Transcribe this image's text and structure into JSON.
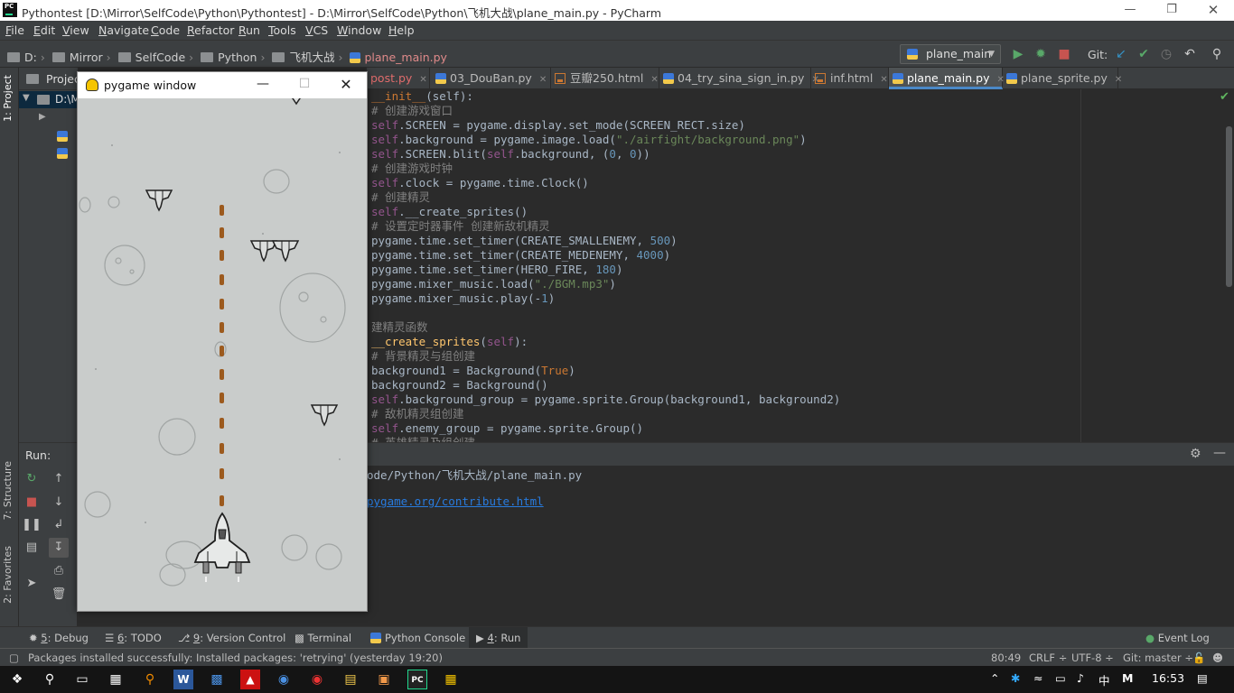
{
  "window_title": "Pythontest [D:\\Mirror\\SelfCode\\Python\\Pythontest] - D:\\Mirror\\SelfCode\\Python\\飞机大战\\plane_main.py - PyCharm",
  "menu": [
    {
      "label": "File",
      "u": "F",
      "rest": "ile"
    },
    {
      "label": "Edit",
      "u": "E",
      "rest": "dit"
    },
    {
      "label": "View",
      "u": "V",
      "rest": "iew"
    },
    {
      "label": "Navigate",
      "u": "N",
      "rest": "avigate"
    },
    {
      "label": "Code",
      "u": "C",
      "rest": "ode"
    },
    {
      "label": "Refactor",
      "u": "R",
      "rest": "efactor"
    },
    {
      "label": "Run",
      "u": "R",
      "rest": "un"
    },
    {
      "label": "Tools",
      "u": "T",
      "rest": "ools"
    },
    {
      "label": "VCS",
      "u": "V",
      "rest": "CS"
    },
    {
      "label": "Window",
      "u": "W",
      "rest": "indow"
    },
    {
      "label": "Help",
      "u": "H",
      "rest": "elp"
    }
  ],
  "breadcrumb": [
    "D:",
    "Mirror",
    "SelfCode",
    "Python",
    "飞机大战",
    "plane_main.py"
  ],
  "run_config": "plane_main",
  "git_label": "Git:",
  "project_panel": {
    "header": "Projec",
    "root": "D:\\M"
  },
  "editor_tabs": [
    {
      "label": "post.py",
      "active": false,
      "kind": "py"
    },
    {
      "label": "03_DouBan.py",
      "active": false,
      "kind": "py"
    },
    {
      "label": "豆瓣250.html",
      "active": false,
      "kind": "html"
    },
    {
      "label": "04_try_sina_sign_in.py",
      "active": false,
      "kind": "py"
    },
    {
      "label": "inf.html",
      "active": false,
      "kind": "html"
    },
    {
      "label": "plane_main.py",
      "active": true,
      "kind": "py"
    },
    {
      "label": "plane_sprite.py",
      "active": false,
      "kind": "py"
    }
  ],
  "code_lines": [
    [
      {
        "c": "kw",
        "t": "__init__"
      },
      {
        "c": "",
        "t": "(self):"
      }
    ],
    [
      {
        "c": "cm",
        "t": "# 创建游戏窗口"
      }
    ],
    [
      {
        "c": "slf",
        "t": "self"
      },
      {
        "c": "",
        "t": ".SCREEN = pygame.display.set_mode(SCREEN_RECT.size)"
      }
    ],
    [
      {
        "c": "slf",
        "t": "self"
      },
      {
        "c": "",
        "t": ".background = pygame.image.load("
      },
      {
        "c": "str",
        "t": "\"./airfight/background.png\""
      },
      {
        "c": "",
        "t": ")"
      }
    ],
    [
      {
        "c": "slf",
        "t": "self"
      },
      {
        "c": "",
        "t": ".SCREEN.blit("
      },
      {
        "c": "slf",
        "t": "self"
      },
      {
        "c": "",
        "t": ".background, ("
      },
      {
        "c": "num",
        "t": "0"
      },
      {
        "c": "",
        "t": ", "
      },
      {
        "c": "num",
        "t": "0"
      },
      {
        "c": "",
        "t": "))"
      }
    ],
    [
      {
        "c": "cm",
        "t": "# 创建游戏时钟"
      }
    ],
    [
      {
        "c": "slf",
        "t": "self"
      },
      {
        "c": "",
        "t": ".clock = pygame.time.Clock()"
      }
    ],
    [
      {
        "c": "cm",
        "t": "# 创建精灵"
      }
    ],
    [
      {
        "c": "slf",
        "t": "self"
      },
      {
        "c": "",
        "t": ".__create_sprites()"
      }
    ],
    [
      {
        "c": "cm",
        "t": "# 设置定时器事件 创建新敌机精灵"
      }
    ],
    [
      {
        "c": "",
        "t": "pygame.time.set_timer(CREATE_SMALLENEMY, "
      },
      {
        "c": "num",
        "t": "500"
      },
      {
        "c": "",
        "t": ")"
      }
    ],
    [
      {
        "c": "",
        "t": "pygame.time.set_timer(CREATE_MEDENEMY, "
      },
      {
        "c": "num",
        "t": "4000"
      },
      {
        "c": "",
        "t": ")"
      }
    ],
    [
      {
        "c": "",
        "t": "pygame.time.set_timer(HERO_FIRE, "
      },
      {
        "c": "num",
        "t": "180"
      },
      {
        "c": "",
        "t": ")"
      }
    ],
    [
      {
        "c": "",
        "t": "pygame.mixer_music.load("
      },
      {
        "c": "str",
        "t": "\"./BGM.mp3\""
      },
      {
        "c": "",
        "t": ")"
      }
    ],
    [
      {
        "c": "",
        "t": "pygame.mixer_music.play(-"
      },
      {
        "c": "num",
        "t": "1"
      },
      {
        "c": "",
        "t": ")"
      }
    ],
    [
      {
        "c": "",
        "t": ""
      }
    ],
    [
      {
        "c": "cm",
        "t": "建精灵函数"
      }
    ],
    [
      {
        "c": "fn",
        "t": "__create_sprites"
      },
      {
        "c": "",
        "t": "("
      },
      {
        "c": "slf",
        "t": "self"
      },
      {
        "c": "",
        "t": "):"
      }
    ],
    [
      {
        "c": "cm",
        "t": "# 背景精灵与组创建"
      }
    ],
    [
      {
        "c": "",
        "t": "background1 = Background("
      },
      {
        "c": "kw",
        "t": "True"
      },
      {
        "c": "",
        "t": ")"
      }
    ],
    [
      {
        "c": "",
        "t": "background2 = Background()"
      }
    ],
    [
      {
        "c": "slf",
        "t": "self"
      },
      {
        "c": "",
        "t": ".background_group = pygame.sprite.Group(background1, background2)"
      }
    ],
    [
      {
        "c": "cm",
        "t": "# 敌机精灵组创建"
      }
    ],
    [
      {
        "c": "slf",
        "t": "self"
      },
      {
        "c": "",
        "t": ".enemy_group = pygame.sprite.Group()"
      }
    ],
    [
      {
        "c": "cm",
        "t": "# 英雄精灵及组创建"
      }
    ]
  ],
  "run_panel": {
    "label": "Run:",
    "tab": "",
    "output_line1": "ode/Python/飞机大战/plane_main.py",
    "output_link": "pygame.org/contribute.html"
  },
  "pygame_window": {
    "title": "pygame window"
  },
  "left_strip": {
    "project": "1: Project",
    "structure": "7: Structure",
    "favorites": "2: Favorites"
  },
  "tool_tabs": [
    {
      "num": "5",
      "label": ": Debug"
    },
    {
      "num": "6",
      "label": ": TODO"
    },
    {
      "num": "9",
      "label": ": Version Control"
    },
    {
      "num": "",
      "label": "Terminal"
    },
    {
      "num": "",
      "label": "Python Console"
    },
    {
      "num": "4",
      "label": ": Run"
    }
  ],
  "event_log": "Event Log",
  "status": {
    "message": "Packages installed successfully: Installed packages: 'retrying' (yesterday 19:20)",
    "position": "80:49",
    "line_sep": "CRLF ÷",
    "encoding": "UTF-8 ÷",
    "git": "Git: master ÷"
  },
  "taskbar": {
    "time": "16:53",
    "ime": "中",
    "ime2": "M"
  }
}
